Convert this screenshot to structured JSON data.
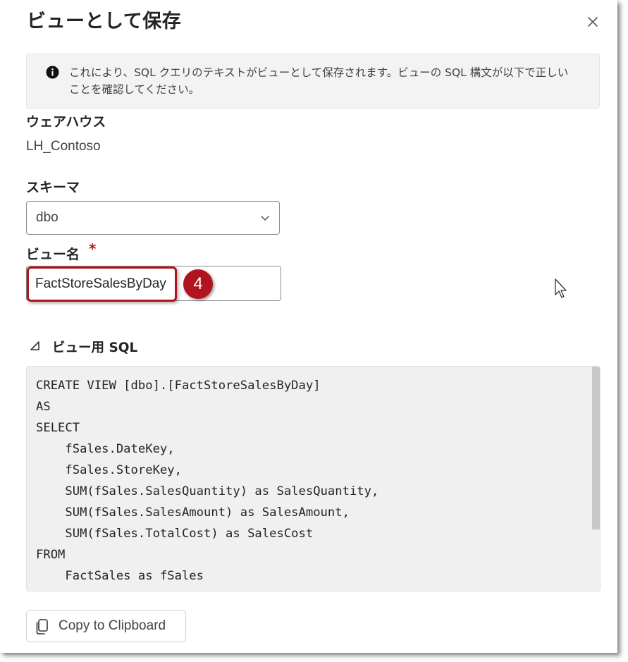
{
  "dialog": {
    "title": "ビューとして保存",
    "close_icon": "close-icon"
  },
  "info": {
    "icon": "info-icon",
    "text": "これにより、SQL クエリのテキストがビューとして保存されます。ビューの SQL 構文が以下で正しいことを確認してください。"
  },
  "warehouse": {
    "label": "ウェアハウス",
    "value": "LH_Contoso"
  },
  "schema": {
    "label": "スキーマ",
    "selected": "dbo",
    "chevron_icon": "chevron-down-icon"
  },
  "view_name": {
    "label": "ビュー名",
    "required_marker": "*",
    "value": "FactStoreSalesByDay",
    "step_badge": "4"
  },
  "sql_section": {
    "collapse_icon": "triangle-collapse-icon",
    "title": "ビュー用 SQL",
    "code": "CREATE VIEW [dbo].[FactStoreSalesByDay]\nAS\nSELECT\n    fSales.DateKey,\n    fSales.StoreKey,\n    SUM(fSales.SalesQuantity) as SalesQuantity,\n    SUM(fSales.SalesAmount) as SalesAmount,\n    SUM(fSales.TotalCost) as SalesCost\nFROM\n    FactSales as fSales"
  },
  "copy_button": {
    "icon": "copy-icon",
    "label": "Copy to Clipboard"
  },
  "colors": {
    "accent_red": "#b0151f",
    "required_red": "#c50f1f",
    "info_bg": "#f3f3f3",
    "code_bg": "#f0f0f0"
  }
}
